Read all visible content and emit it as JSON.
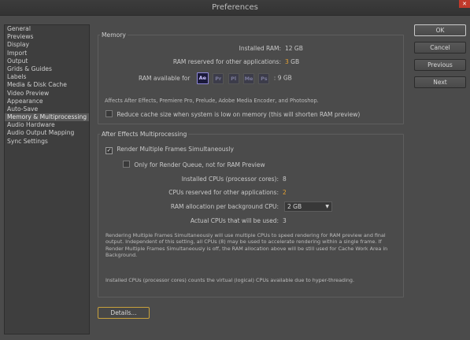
{
  "window": {
    "title": "Preferences",
    "close_label": "✕"
  },
  "sidebar": {
    "items": [
      "General",
      "Previews",
      "Display",
      "Import",
      "Output",
      "Grids & Guides",
      "Labels",
      "Media & Disk Cache",
      "Video Preview",
      "Appearance",
      "Auto-Save",
      "Memory & Multiprocessing",
      "Audio Hardware",
      "Audio Output Mapping",
      "Sync Settings"
    ],
    "selected_index": 11
  },
  "memory": {
    "group_title": "Memory",
    "installed_ram_label": "Installed RAM:",
    "installed_ram_value": "12 GB",
    "reserved_label": "RAM reserved for other applications:",
    "reserved_value": "3",
    "reserved_unit": "GB",
    "available_label": "RAM available for",
    "apps": [
      {
        "abbr": "Ae",
        "icon": "after-effects-icon"
      },
      {
        "abbr": "Pr",
        "icon": "premiere-pro-icon"
      },
      {
        "abbr": "Pl",
        "icon": "prelude-icon"
      },
      {
        "abbr": "Me",
        "icon": "media-encoder-icon"
      },
      {
        "abbr": "Ps",
        "icon": "photoshop-icon"
      }
    ],
    "available_value": ": 9 GB",
    "affects_note": "Affects After Effects, Premiere Pro, Prelude, Adobe Media Encoder, and Photoshop.",
    "reduce_cache_label": "Reduce cache size when system is low on memory (this will shorten RAM preview)"
  },
  "multiprocessing": {
    "group_title": "After Effects Multiprocessing",
    "render_multiple_label": "Render Multiple Frames Simultaneously",
    "render_queue_only_label": "Only for Render Queue, not for RAM Preview",
    "installed_cpus_label": "Installed CPUs (processor cores):",
    "installed_cpus_value": "8",
    "reserved_cpus_label": "CPUs reserved for other applications:",
    "reserved_cpus_value": "2",
    "ram_per_cpu_label": "RAM allocation per background CPU:",
    "ram_per_cpu_value": "2 GB",
    "actual_cpus_label": "Actual CPUs that will be used:",
    "actual_cpus_value": "3",
    "note_1": "Rendering Multiple Frames Simultaneously will use multiple CPUs to speed rendering for RAM preview and final output. Independent of this setting, all CPUs (8) may be used to accelerate rendering within a single frame. If Render Multiple Frames Simultaneously is off, the RAM allocation above will be still used for Cache Work Area in Background.",
    "note_2": "Installed CPUs (processor cores) counts the virtual (logical) CPUs available due to hyper-threading."
  },
  "buttons": {
    "ok": "OK",
    "cancel": "Cancel",
    "previous": "Previous",
    "next": "Next",
    "details": "Details..."
  }
}
